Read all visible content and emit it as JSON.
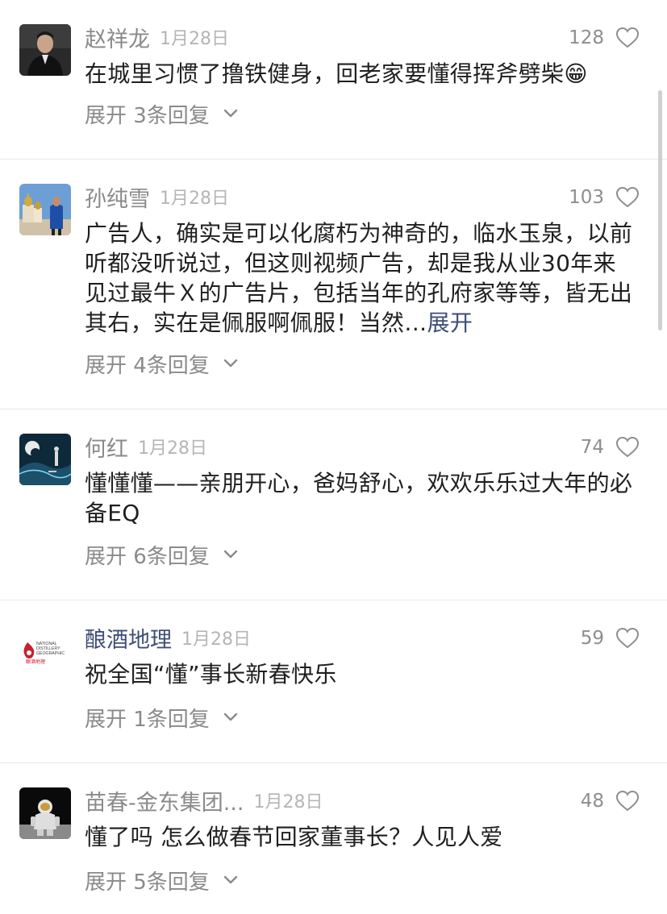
{
  "comments": [
    {
      "author": "赵祥龙",
      "date": "1月28日",
      "likes": "128",
      "text": "在城里习惯了撸铁健身，回老家要懂得挥斧劈柴😁",
      "expand": "",
      "replies": "展开 3条回复",
      "avatar_icon": "person-dark-suit-avatar"
    },
    {
      "author": "孙纯雪",
      "date": "1月28日",
      "likes": "103",
      "text": "广告人，确实是可以化腐朽为神奇的，临水玉泉，以前听都没听说过，但这则视频广告，却是我从业30年来见过最牛Ｘ的广告片，包括当年的孔府家等等，皆无出其右，实在是佩服啊佩服！当然…",
      "expand": "展开",
      "replies": "展开 4条回复",
      "avatar_icon": "cathedral-photo-avatar"
    },
    {
      "author": "何红",
      "date": "1月28日",
      "likes": "74",
      "text": "懂懂懂——亲朋开心，爸妈舒心，欢欢乐乐过大年的必备EQ",
      "expand": "",
      "replies": "展开 6条回复",
      "avatar_icon": "stage-silhouette-avatar"
    },
    {
      "author": "酿酒地理",
      "date": "1月28日",
      "likes": "59",
      "text": "祝全国“懂”事长新春快乐",
      "expand": "",
      "replies": "展开 1条回复",
      "avatar_icon": "national-distillery-logo",
      "logo_text": [
        "NATIONAL",
        "DISTILLERY",
        "GEOGRAPHIC",
        "酿酒地理"
      ]
    },
    {
      "author": "苗春-金东集团...",
      "date": "1月28日",
      "likes": "48",
      "text": "懂了吗 怎么做春节回家董事长？人见人爱",
      "expand": "",
      "replies": "展开 5条回复",
      "avatar_icon": "astronaut-moon-avatar"
    }
  ],
  "colors": {
    "author": "#8a8a8a",
    "brand_author": "#3f4e75",
    "link": "#3f4e75",
    "meta": "#b5b5b5",
    "divider": "#e9e9e9"
  }
}
